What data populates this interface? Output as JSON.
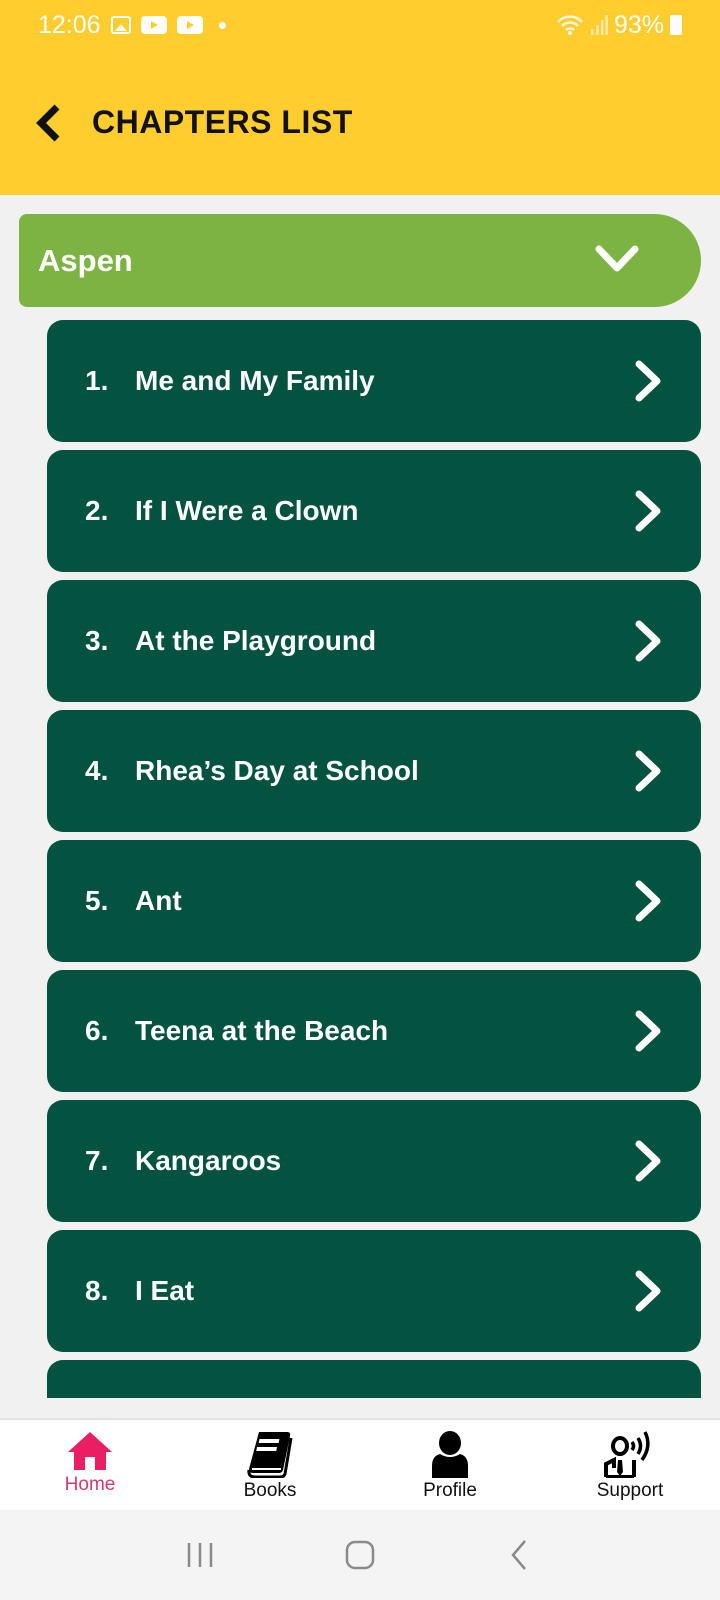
{
  "status_bar": {
    "time": "12:06",
    "battery": "93%",
    "icons": [
      "gallery-icon",
      "youtube-icon",
      "youtube-icon",
      "dot-icon",
      "wifi-icon",
      "signal-icon",
      "battery-icon"
    ]
  },
  "header": {
    "title": "CHAPTERS LIST",
    "back_icon": "chevron-left-icon",
    "background_color": "#ffcd2e"
  },
  "group": {
    "title": "Aspen",
    "expanded": true,
    "icon": "chevron-down-icon",
    "color": "#7cb342"
  },
  "chapters": [
    {
      "number": "1.",
      "title": "Me and My Family"
    },
    {
      "number": "2.",
      "title": "If I Were a Clown"
    },
    {
      "number": "3.",
      "title": "At the Playground"
    },
    {
      "number": "4.",
      "title": "Rhea’s Day at School"
    },
    {
      "number": "5.",
      "title": "Ant"
    },
    {
      "number": "6.",
      "title": "Teena at the Beach"
    },
    {
      "number": "7.",
      "title": "Kangaroos"
    },
    {
      "number": "8.",
      "title": "I Eat"
    }
  ],
  "chapter_color": "#045240",
  "bottom_nav": {
    "items": [
      {
        "label": "Home",
        "icon": "home-icon",
        "active": true
      },
      {
        "label": "Books",
        "icon": "book-icon",
        "active": false
      },
      {
        "label": "Profile",
        "icon": "user-icon",
        "active": false
      },
      {
        "label": "Support",
        "icon": "support-icon",
        "active": false
      }
    ],
    "active_color": "#e91e63"
  },
  "system_nav": {
    "buttons": [
      "recents-icon",
      "home-circle-icon",
      "back-icon"
    ]
  }
}
